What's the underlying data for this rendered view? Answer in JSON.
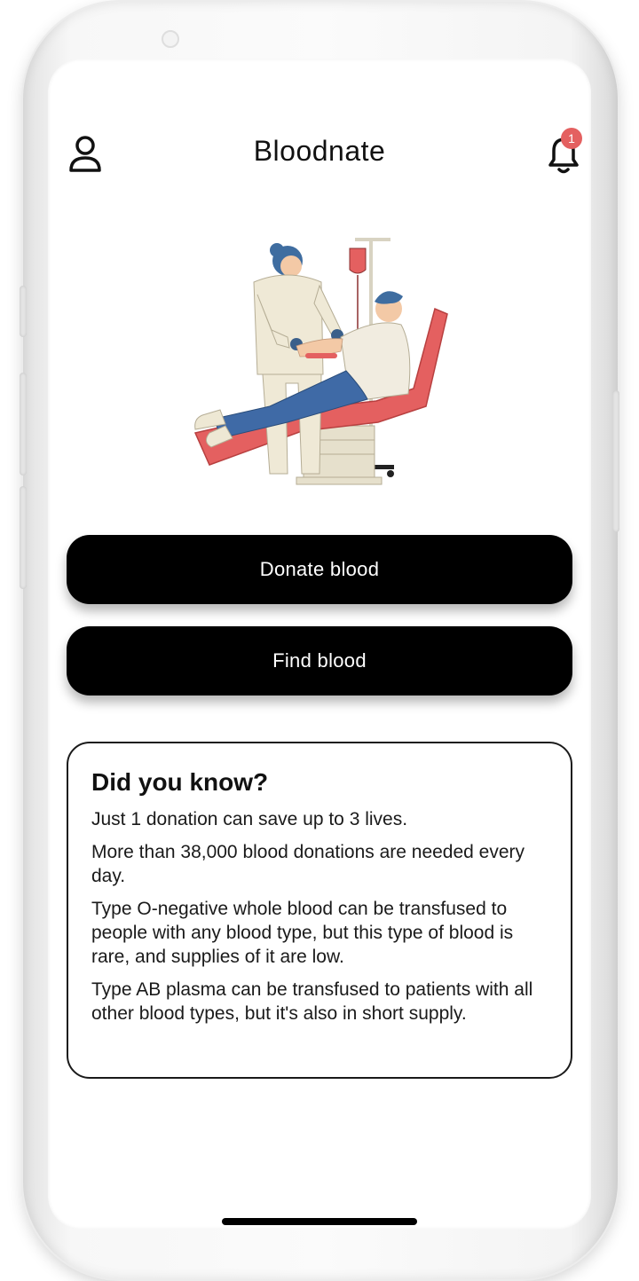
{
  "app": {
    "title": "Bloodnate",
    "notification_count": "1"
  },
  "actions": {
    "donate_label": "Donate blood",
    "find_label": "Find blood"
  },
  "info_card": {
    "title": "Did you know?",
    "facts": [
      "Just 1 donation can save up to 3 lives.",
      "More than 38,000 blood donations are needed every day.",
      "Type O-negative whole blood can be transfused to people with any blood type, but this type of blood is rare, and supplies of it are low.",
      "Type AB plasma can be transfused to patients with all other blood types, but it's also in short supply."
    ]
  },
  "icons": {
    "profile": "user-icon",
    "notifications": "bell-icon"
  },
  "colors": {
    "accent_red": "#e46060",
    "button_bg": "#000000",
    "button_text": "#ffffff"
  }
}
